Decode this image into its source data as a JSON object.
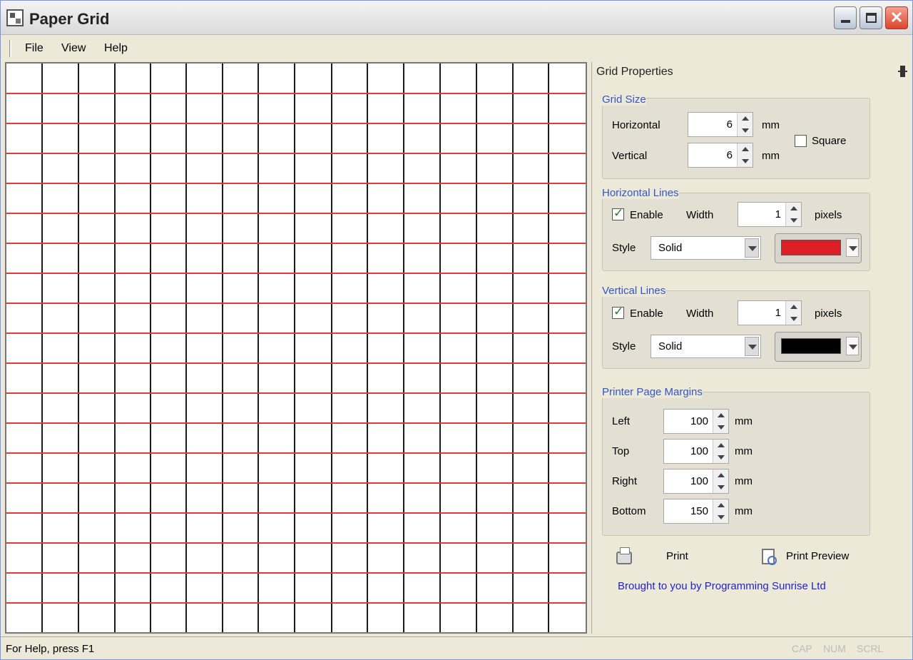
{
  "window": {
    "title": "Paper Grid",
    "controls": {
      "close": "✕"
    }
  },
  "menu": {
    "items": [
      "File",
      "View",
      "Help"
    ]
  },
  "grid_canvas": {
    "horizontal_line_color": "#e53935",
    "vertical_line_color": "#1a1a1a",
    "horizontal_spacing_mm": 6,
    "vertical_spacing_mm": 6
  },
  "panel": {
    "title": "Grid Properties",
    "grid_size": {
      "title": "Grid Size",
      "horizontal_label": "Horizontal",
      "horizontal_value": "6",
      "vertical_label": "Vertical",
      "vertical_value": "6",
      "unit": "mm",
      "square_label": "Square",
      "square_checked": false
    },
    "horizontal_lines": {
      "title": "Horizontal Lines",
      "enable_label": "Enable",
      "enabled": true,
      "width_label": "Width",
      "width_value": "1",
      "width_unit": "pixels",
      "style_label": "Style",
      "style_value": "Solid",
      "color": "#dd1f26"
    },
    "vertical_lines": {
      "title": "Vertical Lines",
      "enable_label": "Enable",
      "enabled": true,
      "width_label": "Width",
      "width_value": "1",
      "width_unit": "pixels",
      "style_label": "Style",
      "style_value": "Solid",
      "color": "#000000"
    },
    "margins": {
      "title": "Printer Page Margins",
      "left_label": "Left",
      "left_value": "100",
      "top_label": "Top",
      "top_value": "100",
      "right_label": "Right",
      "right_value": "100",
      "bottom_label": "Bottom",
      "bottom_value": "150",
      "unit": "mm"
    },
    "print_label": "Print",
    "print_preview_label": "Print Preview",
    "credit": "Brought to you by Programming Sunrise Ltd"
  },
  "status": {
    "text": "For Help, press F1",
    "indicators": [
      "CAP",
      "NUM",
      "SCRL"
    ]
  }
}
